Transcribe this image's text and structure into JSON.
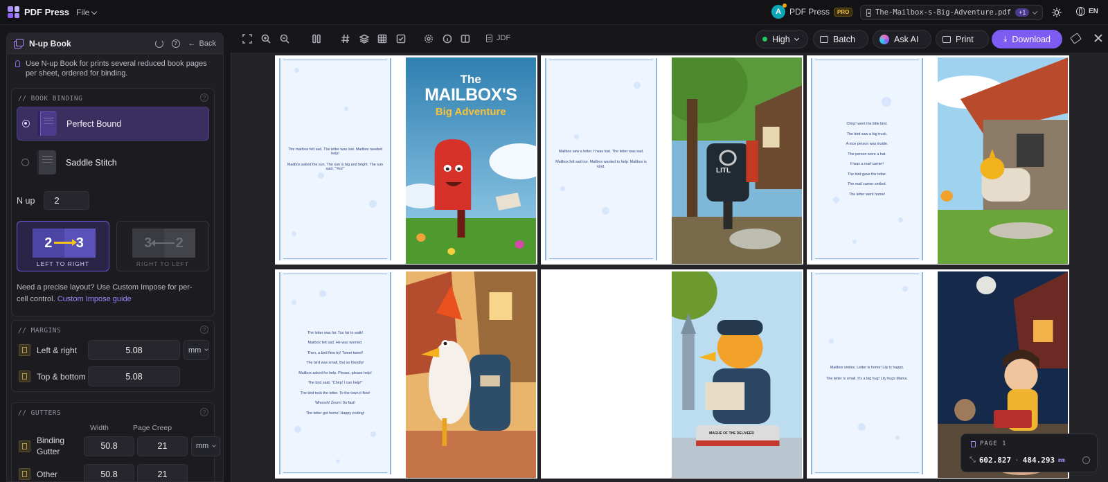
{
  "app": {
    "name": "PDF Press",
    "file_menu": "File"
  },
  "account": {
    "initial": "A",
    "name": "PDF Press",
    "badge": "PRO"
  },
  "file": {
    "name": "The-Mailbox-s-Big-Adventure.pdf",
    "extra": "+1"
  },
  "language": "EN",
  "panel": {
    "title": "N-up Book",
    "back_label": "Back",
    "tip": "Use N-up Book for prints several reduced book pages per sheet, ordered for binding.",
    "binding": {
      "title": "// BOOK BINDING",
      "options": [
        {
          "label": "Perfect Bound",
          "selected": true
        },
        {
          "label": "Saddle Stitch",
          "selected": false
        }
      ]
    },
    "nup": {
      "label": "N up",
      "value": "2"
    },
    "direction": {
      "ltr": {
        "from": "2",
        "to": "3",
        "label": "LEFT TO RIGHT",
        "active": true
      },
      "rtl": {
        "from": "3",
        "to": "2",
        "label": "RIGHT TO LEFT",
        "active": false
      }
    },
    "custom_note": "Need a precise layout? Use Custom Impose for per-cell control.",
    "custom_link": "Custom Impose guide",
    "margins": {
      "title": "// MARGINS",
      "left_right": {
        "label": "Left & right",
        "value": "5.08",
        "unit": "mm"
      },
      "top_bottom": {
        "label": "Top & bottom",
        "value": "5.08"
      }
    },
    "gutters": {
      "title": "// GUTTERS",
      "col_width": "Width",
      "col_creep": "Page Creep",
      "binding": {
        "label": "Binding Gutter",
        "width": "50.8",
        "creep": "21",
        "unit": "mm"
      },
      "other": {
        "label": "Other",
        "width": "50.8",
        "creep": "21"
      }
    }
  },
  "toolbar": {
    "jdf": "JDF",
    "quality": "High",
    "batch": "Batch",
    "ask_ai": "Ask AI",
    "print": "Print",
    "download": "Download"
  },
  "sheets": [
    {
      "text": [
        "The mailbox felt sad.  The letter was lost.  Mailbox needed help!",
        "Mailbox asked the sun.  The sun is big and bright.  The sun said, \"Yes!\""
      ],
      "cover": {
        "the": "The",
        "title": "MAILBOX'S",
        "subtitle": "Big Adventure"
      }
    },
    {
      "text": [
        "Mailbox saw a letter. It was lost. The letter was sad.",
        "Mailbox felt sad too.  Mailbox wanted to help.  Mailbox is kind."
      ],
      "sign": "LITL"
    },
    {
      "text": [
        "Chirp! went the little bird.",
        "The bird saw a big truck.",
        "A nice person was inside.",
        "The person wore a hat.",
        "It was a mail carrier!",
        "The bird gave the letter.",
        "The mail carrier smiled.",
        "The letter went home!"
      ]
    },
    {
      "text": [
        "The letter was far. Too far to walk!",
        "Mailbox felt sad.  He was worried.",
        "Then, a bird flew by!  Tweet tweet!",
        "The bird was small.  But so friendly!",
        "Mailbox asked for help.  Please, please help!",
        "The bird said, \"Chirp! I can help!\"",
        "The bird took the letter.  To the town it flew!",
        "Whoosh! Zoom!  So fast!",
        "The letter got home!  Happy ending!"
      ]
    },
    {
      "text": [],
      "plaque": "MAGUE OF THE DELIVEER"
    },
    {
      "text": [
        "Mailbox smiles.  Letter is home!  Lily is happy.",
        "The letter is small.  It's a big hug!  Lily hugs Mama."
      ]
    }
  ],
  "page_badge": {
    "label": "PAGE 1",
    "width": "602.827",
    "height": "484.293",
    "unit": "mm"
  },
  "colors": {
    "accent": "#7c5cf2",
    "panel": "#1e1e23",
    "selected": "#3a2f5f",
    "highlight": "#f5c518"
  }
}
